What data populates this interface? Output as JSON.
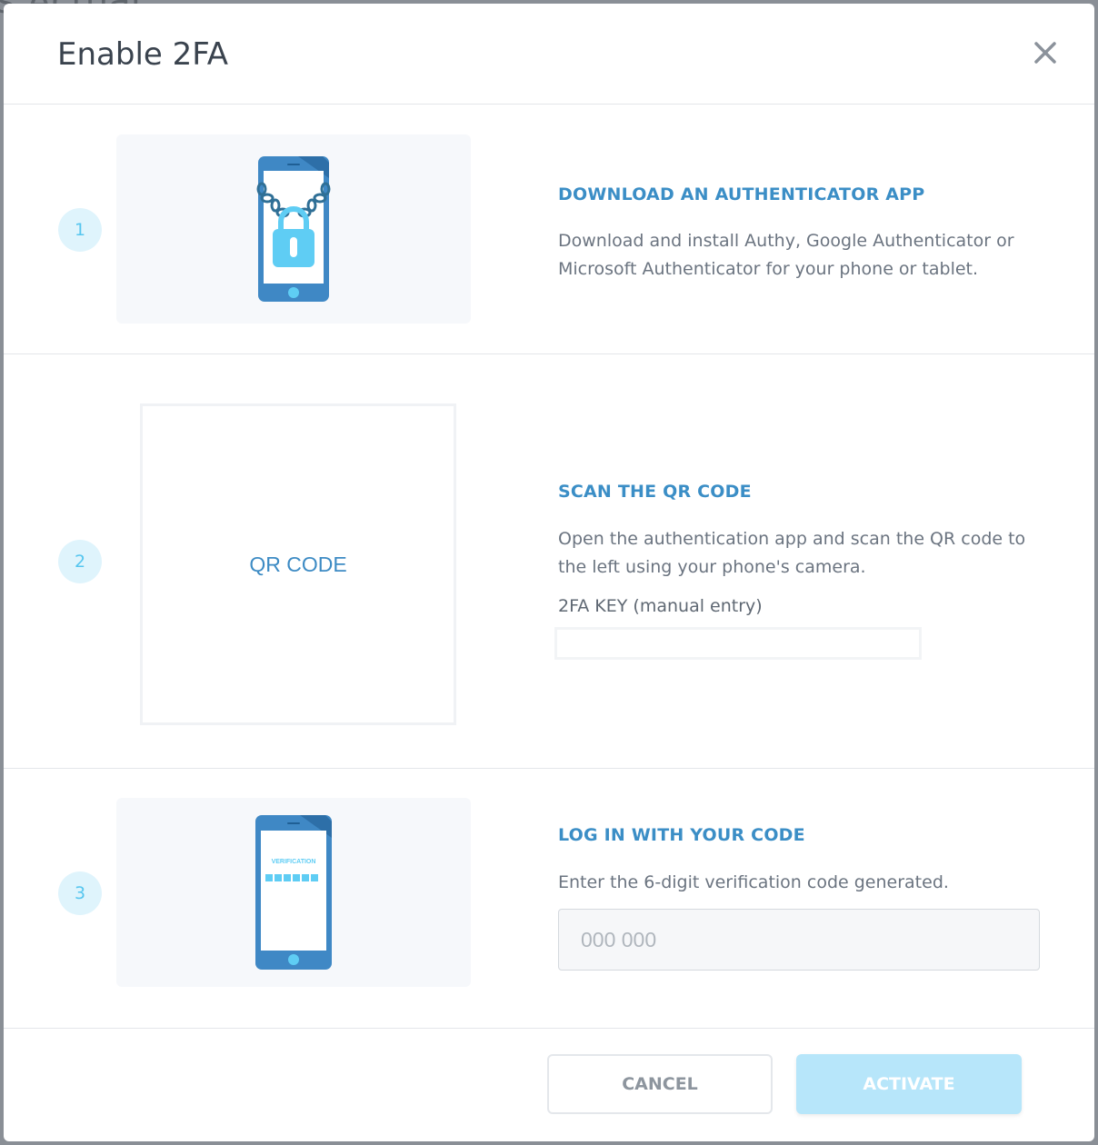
{
  "background": {
    "partial_text": "s Actual"
  },
  "modal": {
    "title": "Enable 2FA",
    "close_icon": "close-icon"
  },
  "steps": [
    {
      "number": "1",
      "title": "DOWNLOAD AN AUTHENTICATOR APP",
      "description": "Download and install Authy, Google Authenticator or Microsoft Authenticator for your phone or tablet.",
      "illustration": "phone-lock-icon"
    },
    {
      "number": "2",
      "title": "SCAN THE QR CODE",
      "description": "Open the authentication app and scan the QR code to the left using your phone's camera.",
      "qr_placeholder": "QR CODE",
      "key_label": "2FA KEY (manual entry)",
      "key_value": ""
    },
    {
      "number": "3",
      "title": "LOG IN WITH YOUR CODE",
      "description": "Enter the 6-digit verification code generated.",
      "illustration": "phone-verification-icon",
      "illustration_text": "VERIFICATION",
      "input_value": "",
      "input_placeholder": "000 000"
    }
  ],
  "footer": {
    "cancel_label": "CANCEL",
    "activate_label": "ACTIVATE"
  },
  "colors": {
    "accent_blue": "#3b8ec6",
    "light_blue": "#56c6ef",
    "activate_bg": "#b7e6fa",
    "step_bg": "#dff4fc"
  }
}
